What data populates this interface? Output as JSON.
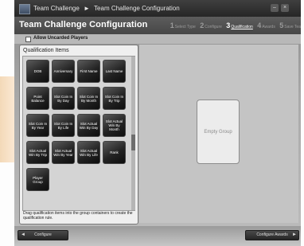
{
  "titlebar": {
    "app_name": "Team Challenge",
    "separator": "►",
    "page": "Team Challenge Configuration"
  },
  "header": {
    "title": "Team Challenge Configuration",
    "steps": [
      {
        "num": "1",
        "label": "Select Type",
        "active": false
      },
      {
        "num": "2",
        "label": "Configure",
        "active": false
      },
      {
        "num": "3",
        "label": "Qualification",
        "active": true
      },
      {
        "num": "4",
        "label": "Awards",
        "active": false
      },
      {
        "num": "5",
        "label": "Save Tea",
        "active": false
      }
    ]
  },
  "options": {
    "allow_uncarded_label": "Allow Uncarded Players",
    "allow_uncarded_checked": false
  },
  "qualification": {
    "title": "Qualification Items",
    "items": [
      "DOB",
      "Anniversary",
      "First Name",
      "Last Name",
      "Point Balance",
      "Slot Coin In By Day",
      "Slot Coin In By Month",
      "Slot Coin In By Trip",
      "Slot Coin In By Year",
      "Slot Coin In By Life",
      "Slot Actual Win By Day",
      "Slot Actual Win By Month",
      "Slot Actual Win By Trip",
      "Slot Actual Win By Year",
      "Slot Actual Win By Life",
      "Rank",
      "Player Group"
    ],
    "hint": "Drag qualification items into the group containers to create the qualification rule."
  },
  "group_area": {
    "empty_group_label": "Empty Group"
  },
  "footer": {
    "back_label": "Configure",
    "next_label": "Configure Awards"
  }
}
